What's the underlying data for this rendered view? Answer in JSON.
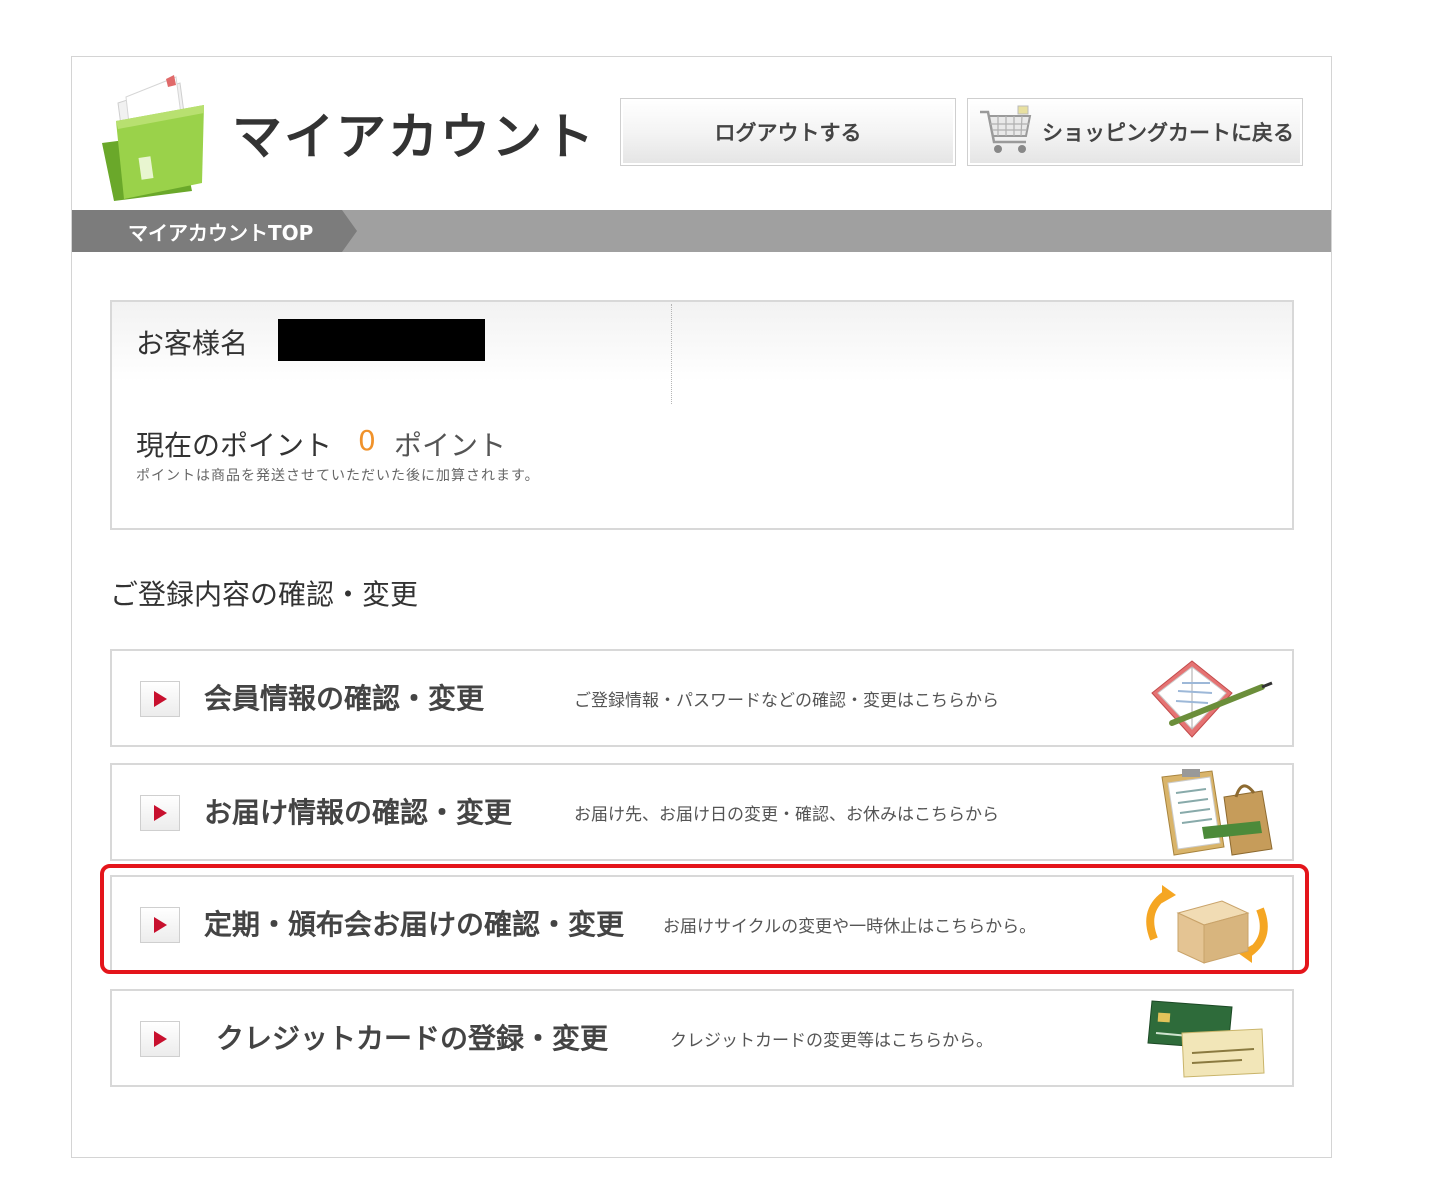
{
  "header": {
    "title": "マイアカウント",
    "logout_label": "ログアウトする",
    "cart_label": "ショッピングカートに戻る"
  },
  "breadcrumb": {
    "current": "マイアカウントTOP"
  },
  "customer": {
    "name_label": "お客様名",
    "points_label": "現在のポイント",
    "points_value": "0",
    "points_unit": "ポイント",
    "points_note": "ポイントは商品を発送させていただいた後に加算されます。"
  },
  "section": {
    "title": "ご登録内容の確認・変更"
  },
  "menu": [
    {
      "title": "会員情報の確認・変更",
      "desc": "ご登録情報・パスワードなどの確認・変更はこちらから",
      "icon": "notebook-pen-icon"
    },
    {
      "title": "お届け情報の確認・変更",
      "desc": "お届け先、お届け日の変更・確認、お休みはこちらから",
      "icon": "clipboard-bag-icon"
    },
    {
      "title": "定期・頒布会お届けの確認・変更",
      "desc": "お届けサイクルの変更や一時休止はこちらから。",
      "icon": "box-cycle-icon"
    },
    {
      "title": "クレジットカードの登録・変更",
      "desc": "クレジットカードの変更等はこちらから。",
      "icon": "credit-card-icon"
    }
  ],
  "colors": {
    "accent_orange": "#f0922b",
    "highlight_red": "#e4151b",
    "arrow_red": "#c8102e",
    "folder_green": "#8cc63f"
  }
}
